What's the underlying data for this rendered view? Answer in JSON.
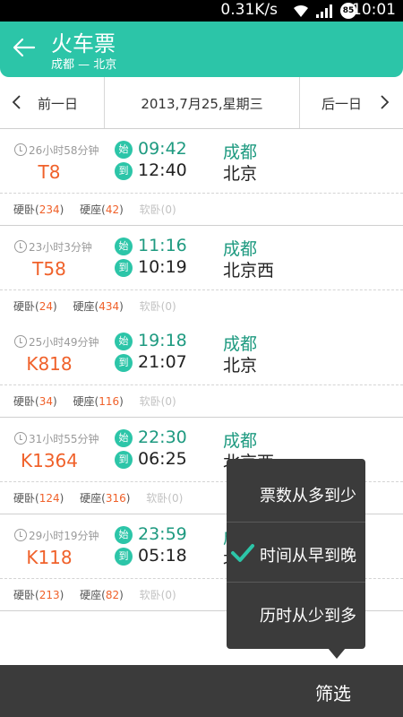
{
  "status_bar": {
    "net_speed": "0.31K/s",
    "battery": "85",
    "time": "10:01"
  },
  "header": {
    "title": "火车票",
    "subtitle": "成都 — 北京"
  },
  "date_nav": {
    "prev_label": "前一日",
    "date": "2013,7月25,星期三",
    "next_label": "后一日"
  },
  "trains": [
    {
      "duration": "26小时58分钟",
      "number": "T8",
      "start_badge": "始",
      "end_badge": "到",
      "depart": "09:42",
      "arrive": "12:40",
      "from": "成都",
      "to": "北京",
      "seats": {
        "hard_sleeper_label": "硬卧",
        "hard_sleeper": "234",
        "hard_seat_label": "硬座",
        "hard_seat": "42",
        "soft_sleeper_label": "软卧",
        "soft_sleeper": "0"
      }
    },
    {
      "duration": "23小时3分钟",
      "number": "T58",
      "start_badge": "始",
      "end_badge": "到",
      "depart": "11:16",
      "arrive": "10:19",
      "from": "成都",
      "to": "北京西",
      "seats": {
        "hard_sleeper_label": "硬卧",
        "hard_sleeper": "24",
        "hard_seat_label": "硬座",
        "hard_seat": "434",
        "soft_sleeper_label": "软卧",
        "soft_sleeper": "0"
      }
    },
    {
      "duration": "25小时49分钟",
      "number": "K818",
      "start_badge": "始",
      "end_badge": "到",
      "depart": "19:18",
      "arrive": "21:07",
      "from": "成都",
      "to": "北京",
      "seats": {
        "hard_sleeper_label": "硬卧",
        "hard_sleeper": "34",
        "hard_seat_label": "硬座",
        "hard_seat": "116",
        "soft_sleeper_label": "软卧",
        "soft_sleeper": "0"
      }
    },
    {
      "duration": "31小时55分钟",
      "number": "K1364",
      "start_badge": "始",
      "end_badge": "到",
      "depart": "22:30",
      "arrive": "06:25",
      "from": "成都",
      "to": "北京西",
      "seats": {
        "hard_sleeper_label": "硬卧",
        "hard_sleeper": "124",
        "hard_seat_label": "硬座",
        "hard_seat": "316",
        "soft_sleeper_label": "软卧",
        "soft_sleeper": "0"
      }
    },
    {
      "duration": "29小时19分钟",
      "number": "K118",
      "start_badge": "始",
      "end_badge": "到",
      "depart": "23:59",
      "arrive": "05:18",
      "from": "成都",
      "to": "北京",
      "seats": {
        "hard_sleeper_label": "硬卧",
        "hard_sleeper": "213",
        "hard_seat_label": "硬座",
        "hard_seat": "82",
        "soft_sleeper_label": "软卧",
        "soft_sleeper": "0"
      }
    }
  ],
  "sort_menu": {
    "items": [
      {
        "label": "票数从多到少",
        "selected": false
      },
      {
        "label": "时间从早到晚",
        "selected": true
      },
      {
        "label": "历时从少到多",
        "selected": false
      }
    ]
  },
  "bottom_bar": {
    "filter_label": "筛选"
  },
  "colors": {
    "accent": "#2cc5a8",
    "train_number": "#f0612a",
    "popup_bg": "#3b3b3b"
  }
}
